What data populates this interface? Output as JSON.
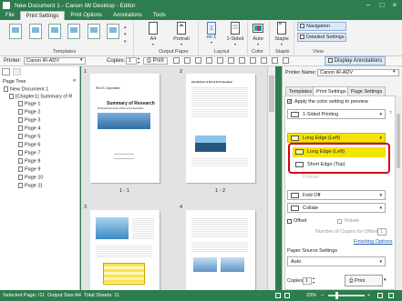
{
  "window": {
    "title": "New Document 1 - Canon iW Desktop - Editor"
  },
  "menu": {
    "items": [
      "File",
      "Print Settings",
      "Print Options",
      "Annotations",
      "Tools"
    ]
  },
  "ribbon": {
    "groups": {
      "templates": "Templates",
      "output_paper": "Output Paper",
      "layout": "Layout",
      "color": "Color",
      "staple": "Staple",
      "view": "View"
    },
    "paper_size": "A4",
    "orientation": "Portrait",
    "pages_per_sheet_value": "1",
    "pages_per_sheet_label": "on 1",
    "sided": "1-Sided",
    "color": "Auto",
    "staple": "Staple",
    "navigation": "Navigation",
    "detailed_settings": "Detailed Settings"
  },
  "toolbar": {
    "printer_label": "Printer:",
    "printer_value": "Canon iR-ADV",
    "copies_label": "Copies:",
    "copies_value": "1",
    "print": "Print",
    "display_annotations": "Display Annotations"
  },
  "page_tree": {
    "label": "Page Tree",
    "root": "New Document 1",
    "chapter": "[Chapter1] Summary of R",
    "pages": [
      "Page 1",
      "Page 2",
      "Page 3",
      "Page 4",
      "Page 5",
      "Page 6",
      "Page 7",
      "Page 8",
      "Page 9",
      "Page 10",
      "Page 11"
    ]
  },
  "thumbnails": [
    {
      "number": "1",
      "caption": "1 - 1",
      "header": "Rxx IS Corporation",
      "title": "Summary of Research",
      "subtitle": "Technical Summary of Rxx & IS Corporation"
    },
    {
      "number": "2",
      "caption": "1 - 2",
      "header": "Introduction of Rxx & IS Corporation"
    },
    {
      "number": "3",
      "caption": ""
    },
    {
      "number": "4",
      "caption": ""
    }
  ],
  "right": {
    "printer_name_label": "Printer Name:",
    "printer_name_value": "Canon iR-ADV",
    "tabs": [
      "Templates",
      "Print Settings",
      "Page Settings"
    ],
    "apply_color": "Apply the color setting to preview",
    "sided": "1-Sided Printing",
    "binding": "Long Edge (Left)",
    "options": [
      "Long Edge (Left)",
      "Short Edge (Top)"
    ],
    "partial_hidden": "Portrait",
    "fold": "Fold Off",
    "collate": "Collate",
    "offset": "Offset",
    "rotate": "Rotate",
    "copies_offset_label": "Number of Copies for Offset:",
    "copies_offset_value": "1",
    "finishing_options": "Finishing Options",
    "paper_source_label": "Paper Source Settings",
    "paper_source_value": "Auto",
    "copies_label": "Copies:",
    "copies_value": "1",
    "print": "Print"
  },
  "status": {
    "selected_page": "Selected Page: /11",
    "output_size": "Output Size:A4",
    "total_sheets": "Total Sheets: 11",
    "zoom": "23%"
  },
  "colors": {
    "brand": "#2e7d4f",
    "highlight": "#f5e300",
    "callout": "#d0021b"
  }
}
